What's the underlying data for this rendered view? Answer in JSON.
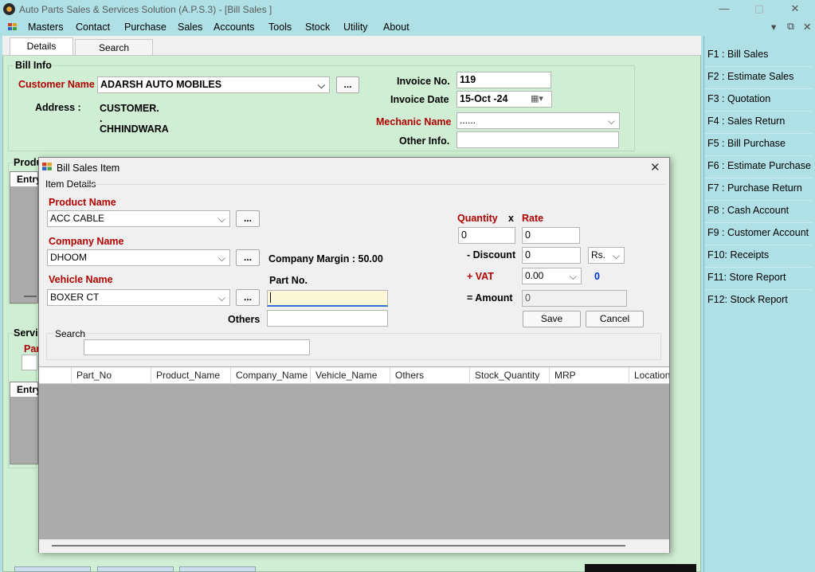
{
  "window": {
    "title": "Auto Parts Sales & Services Solution (A.P.S.3) - [Bill Sales ]",
    "minimize": "—",
    "maximize": "▢",
    "close": "✕"
  },
  "menu": {
    "items": [
      "Masters",
      "Contact",
      "Purchase",
      "Sales",
      "Accounts",
      "Tools",
      "Stock",
      "Utility",
      "About"
    ],
    "mdi_restore": "⧉",
    "mdi_close": "✕",
    "mdi_min": "▾"
  },
  "tabs": [
    "Details",
    "Search"
  ],
  "bill_info": {
    "group_label": "Bill Info",
    "customer_name_label": "Customer Name",
    "customer_name_value": "ADARSH AUTO MOBILES",
    "browse": "...",
    "address_label": "Address :",
    "address_line1": "CUSTOMER.",
    "address_line2": ".",
    "address_line3": "CHHINDWARA",
    "invoice_no_label": "Invoice No.",
    "invoice_no_value": "119",
    "invoice_date_label": "Invoice Date",
    "invoice_date_value": "15-Oct -24",
    "mechanic_label": "Mechanic Name",
    "mechanic_value": "......",
    "other_info_label": "Other Info."
  },
  "background_partial": {
    "product_group": "Produ",
    "entry1": "Entry",
    "service_group": "Servi",
    "par": "Par",
    "entry2": "Entry"
  },
  "function_keys": [
    "F1  : Bill Sales",
    "F2  : Estimate Sales",
    "F3  : Quotation",
    "F4  : Sales Return",
    "F5  : Bill Purchase",
    "F6  : Estimate Purchase",
    "F7  : Purchase Return",
    "F8  : Cash Account",
    "F9  : Customer Account",
    "F10: Receipts",
    "F11: Store Report",
    "F12: Stock Report"
  ],
  "dialog": {
    "title": "Bill Sales Item",
    "close": "✕",
    "group_label": "Item Details",
    "product_name_label": "Product Name",
    "product_name_value": "ACC CABLE",
    "company_name_label": "Company Name",
    "company_name_value": "DHOOM",
    "company_margin_label": "Company Margin : 50.00",
    "vehicle_name_label": "Vehicle Name",
    "vehicle_name_value": "BOXER CT",
    "part_no_label": "Part No.",
    "part_no_value": "",
    "others_label": "Others",
    "others_value": "",
    "browse": "...",
    "quantity_label": "Quantity",
    "x_label": "x",
    "rate_label": "Rate",
    "quantity_value": "0",
    "rate_value": "0",
    "discount_label": "- Discount",
    "discount_value": "0",
    "discount_unit": "Rs.",
    "vat_label": "+ VAT",
    "vat_value": "0.00",
    "vat_amount": "0",
    "amount_label": "= Amount",
    "amount_value": "0",
    "save_label": "Save",
    "cancel_label": "Cancel",
    "search_group_label": "Search",
    "search_value": "",
    "grid_columns": [
      "Part_No",
      "Product_Name",
      "Company_Name",
      "Vehicle_Name",
      "Others",
      "Stock_Quantity",
      "MRP",
      "Location_"
    ]
  }
}
